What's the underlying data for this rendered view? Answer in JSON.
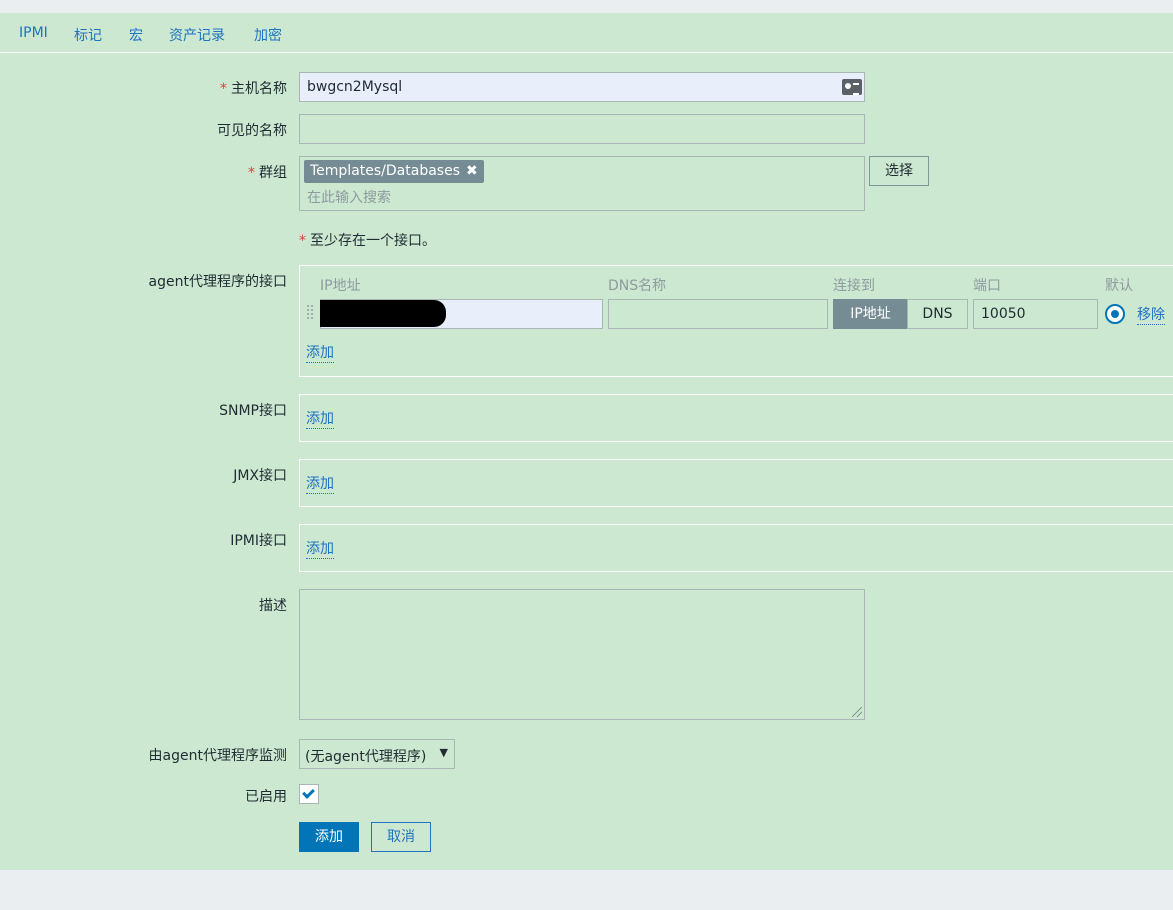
{
  "tabs": [
    "IPMI",
    "标记",
    "宏",
    "资产记录",
    "加密"
  ],
  "form": {
    "required_mark": "*",
    "host_name": {
      "label": "主机名称",
      "value": "bwgcn2Mysql"
    },
    "visible_name": {
      "label": "可见的名称",
      "value": ""
    },
    "groups": {
      "label": "群组",
      "tag": "Templates/Databases",
      "remove_glyph": "✖",
      "placeholder": "在此输入搜索",
      "select_button": "选择"
    },
    "interface_note": "至少存在一个接口。",
    "agent_interfaces": {
      "label": "agent代理程序的接口",
      "columns": {
        "ip": "IP地址",
        "dns": "DNS名称",
        "connect": "连接到",
        "port": "端口",
        "default": "默认"
      },
      "row": {
        "ip_value": "",
        "dns_value": "",
        "connect_ip": "IP地址",
        "connect_dns": "DNS",
        "port": "10050",
        "remove": "移除"
      },
      "add": "添加"
    },
    "snmp_interfaces": {
      "label": "SNMP接口",
      "add": "添加"
    },
    "jmx_interfaces": {
      "label": "JMX接口",
      "add": "添加"
    },
    "ipmi_interfaces": {
      "label": "IPMI接口",
      "add": "添加"
    },
    "description": {
      "label": "描述",
      "value": ""
    },
    "monitored_by_proxy": {
      "label": "由agent代理程序监测",
      "value": "(无agent代理程序)",
      "arrow": "▼"
    },
    "enabled": {
      "label": "已启用",
      "checked": true
    },
    "buttons": {
      "add": "添加",
      "cancel": "取消"
    }
  },
  "colors": {
    "accent": "#0275b8",
    "panel_bg": "#cde8d0",
    "link": "#1e73c2",
    "tag_bg": "#758c95"
  }
}
